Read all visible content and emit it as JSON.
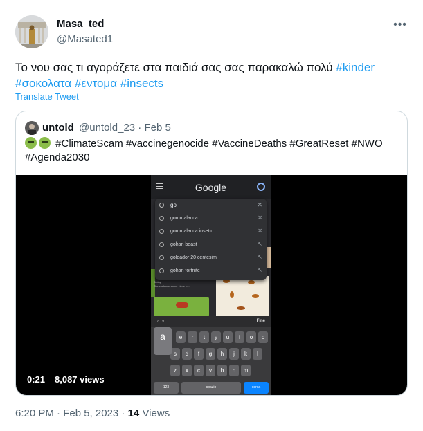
{
  "author": {
    "name": "Masa_ted",
    "handle": "@Masated1"
  },
  "tweet": {
    "text": "Το νου σας τι αγοράζετε στα παιδιά σας σας παρακαλώ  πολύ ",
    "hashtags": [
      "#kinder",
      "#σοκολατα",
      "#εντομα",
      "#insects"
    ],
    "translate_label": "Translate Tweet"
  },
  "quote": {
    "name": "untold",
    "meta": "@untold_23 · Feb 5",
    "text": "#ClimateScam #vaccinegenocide #VaccineDeaths #GreatReset #NWO",
    "text_line2": "#Agenda2030",
    "video": {
      "duration": "0:21",
      "views": "8,087 views",
      "phone": {
        "brand": "Google",
        "query": "go",
        "suggestions": [
          "gommalacca",
          "gommalacca insetto",
          "gohan beast",
          "goleador 20 centesimi",
          "gohan fortnite"
        ],
        "thumb_caption": "Gommalacca come viene p...",
        "thumb_source": "Today",
        "keyboard_done": "Fine",
        "keyboard_row1": [
          "a",
          "e",
          "r",
          "t",
          "y",
          "u",
          "i",
          "o",
          "p"
        ],
        "keyboard_row2": [
          "s",
          "d",
          "f",
          "g",
          "h",
          "j",
          "k",
          "l"
        ],
        "keyboard_row3": [
          "z",
          "x",
          "c",
          "v",
          "b",
          "n",
          "m"
        ],
        "keyboard_num": "123",
        "keyboard_space": "spazio",
        "keyboard_search": "cerca"
      }
    }
  },
  "footer": {
    "time": "6:20 PM · Feb 5, 2023 · ",
    "views_count": "14",
    "views_label": " Views"
  },
  "colors": {
    "link": "#1d9bf0",
    "secondary_text": "#536471",
    "border": "#cfd9de"
  }
}
